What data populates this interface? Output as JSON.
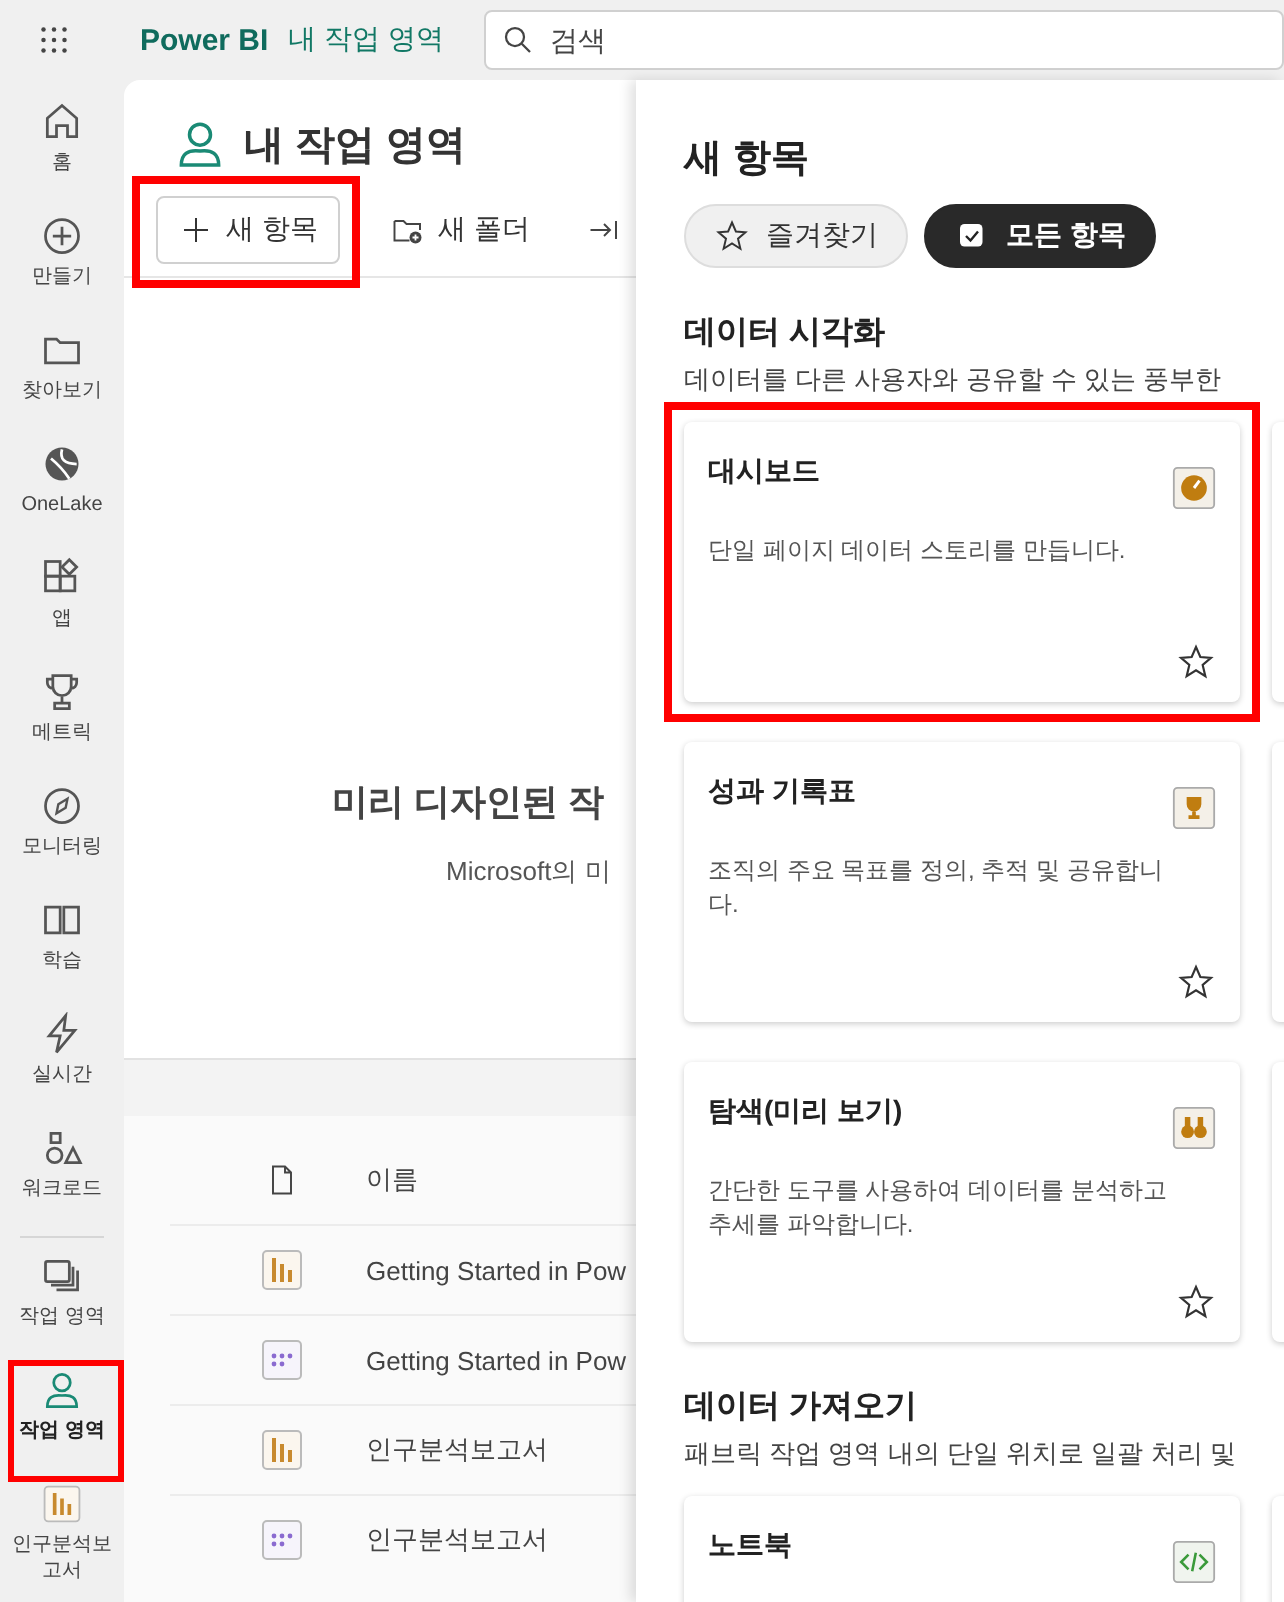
{
  "topbar": {
    "app_name": "Power BI",
    "workspace": "내 작업 영역",
    "search": {
      "placeholder": "검색"
    }
  },
  "nav": {
    "main_items": [
      {
        "label": "홈",
        "kind": "home",
        "selected": false,
        "highlighted": false
      },
      {
        "label": "만들기",
        "kind": "create",
        "selected": false,
        "highlighted": false
      },
      {
        "label": "찾아보기",
        "kind": "browse",
        "selected": false,
        "highlighted": false
      },
      {
        "label": "OneLake",
        "kind": "onelake",
        "selected": false,
        "highlighted": false
      },
      {
        "label": "앱",
        "kind": "apps",
        "selected": false,
        "highlighted": false
      },
      {
        "label": "메트릭",
        "kind": "metrics",
        "selected": false,
        "highlighted": false
      },
      {
        "label": "모니터링",
        "kind": "monitor",
        "selected": false,
        "highlighted": false
      },
      {
        "label": "학습",
        "kind": "learn",
        "selected": false,
        "highlighted": false
      },
      {
        "label": "실시간",
        "kind": "realtime",
        "selected": false,
        "highlighted": false
      },
      {
        "label": "워크로드",
        "kind": "workload",
        "selected": false,
        "highlighted": false
      }
    ],
    "workspace_items": [
      {
        "label": "작업 영역",
        "kind": "workspaces",
        "selected": false,
        "highlighted": false
      },
      {
        "label": "작업 영역",
        "kind": "person",
        "selected": true,
        "highlighted": true
      },
      {
        "label": "인구분석보고서",
        "kind": "report",
        "selected": false,
        "highlighted": false
      }
    ]
  },
  "main": {
    "title": "내 작업 영역",
    "toolbar": [
      {
        "label": "새 항목",
        "kind": "plus",
        "highlighted": true
      },
      {
        "label": "새 폴더",
        "kind": "folder",
        "highlighted": false
      },
      {
        "kind": "import",
        "highlighted": false
      }
    ],
    "promo": {
      "title": "미리 디자인된 작",
      "text": "Microsoft의 미"
    },
    "table": {
      "columns": [
        "이름"
      ],
      "rows": [
        {
          "kind": "report",
          "name": "Getting Started in Pow"
        },
        {
          "kind": "model",
          "name": "Getting Started in Pow"
        },
        {
          "kind": "report",
          "name": "인구분석보고서"
        },
        {
          "kind": "model",
          "name": "인구분석보고서"
        }
      ]
    }
  },
  "panel": {
    "title": "새 항목",
    "filters": [
      {
        "label": "즐겨찾기",
        "kind": "star",
        "selected": false
      },
      {
        "label": "모든 항목",
        "kind": "check",
        "selected": true
      }
    ],
    "sections": [
      {
        "title": "데이터 시각화",
        "description": "데이터를 다른 사용자와 공유할 수 있는 풍부한",
        "cards": [
          {
            "title": "대시보드",
            "description": "단일 페이지 데이터 스토리를 만듭니다.",
            "kind": "dashboard",
            "favorite": false,
            "highlighted": true
          },
          {
            "title": "성과 기록표",
            "description": "조직의 주요 목표를 정의, 추적 및 공유합니다.",
            "kind": "scorecard",
            "favorite": false,
            "highlighted": false
          },
          {
            "title": "탐색(미리 보기)",
            "description": "간단한 도구를 사용하여 데이터를 분석하고 추세를 파악합니다.",
            "kind": "explore",
            "favorite": false,
            "highlighted": false
          }
        ]
      },
      {
        "title": "데이터 가져오기",
        "description": "패브릭 작업 영역 내의 단일 위치로 일괄 처리 및",
        "cards": [
          {
            "title": "노트북",
            "kind": "notebook",
            "highlighted": false
          }
        ]
      }
    ]
  }
}
